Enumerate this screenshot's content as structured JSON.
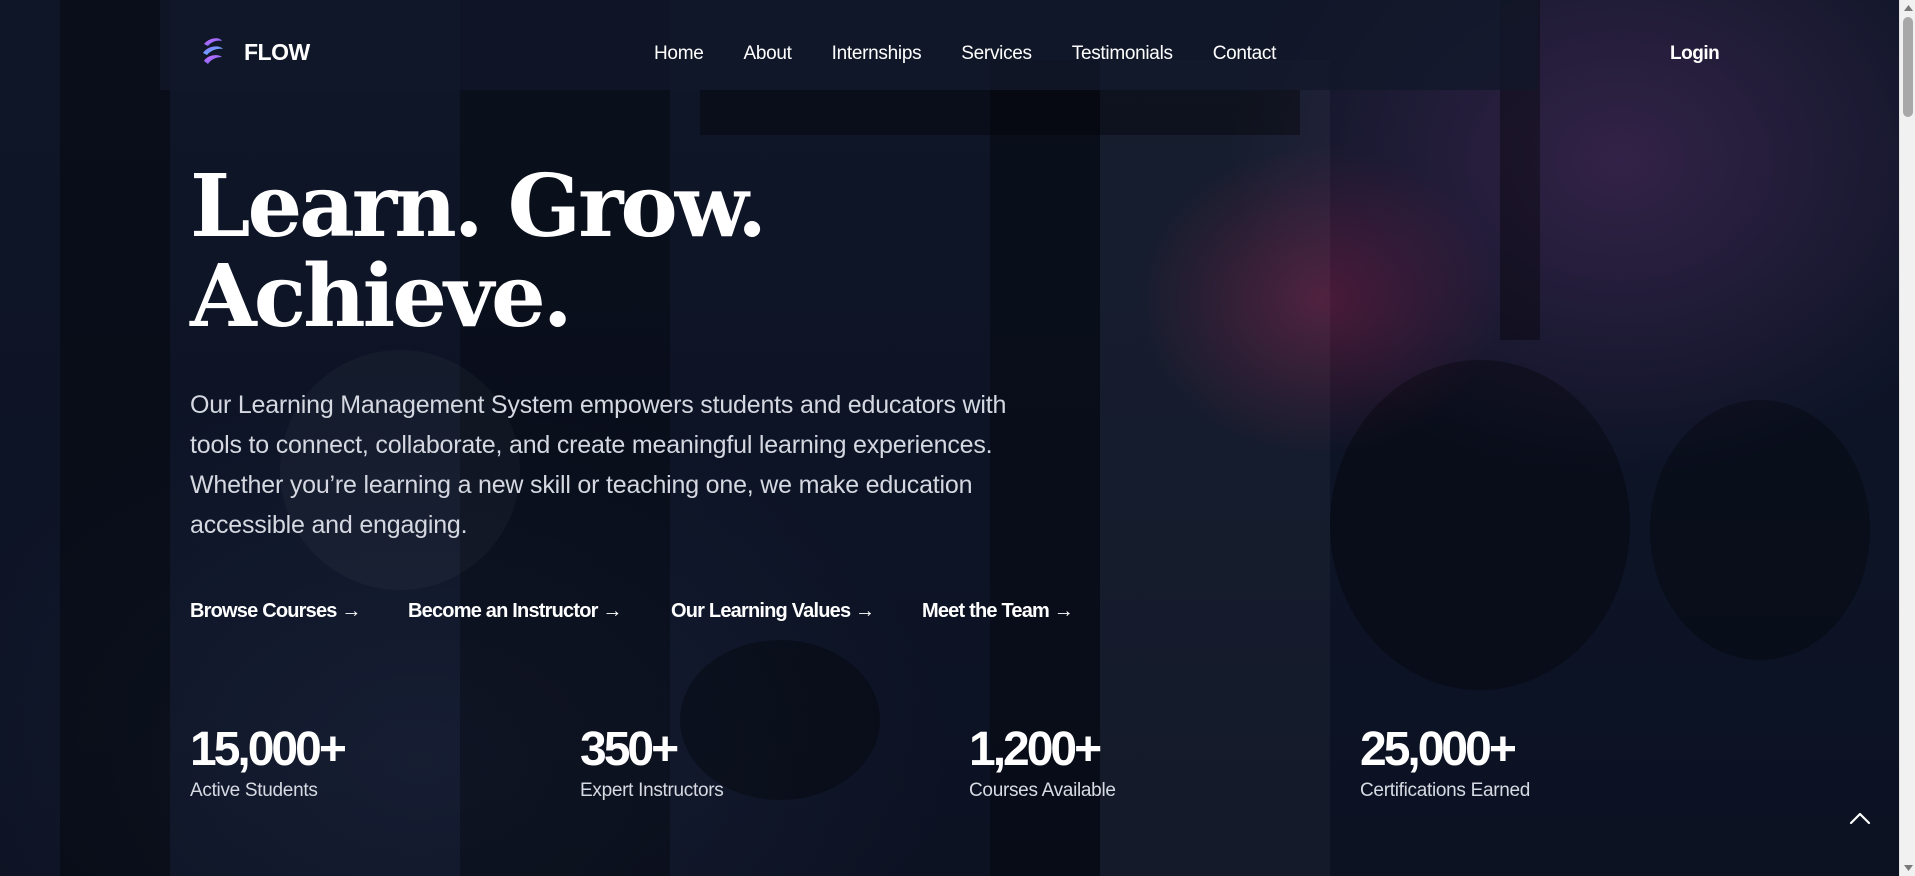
{
  "navbar": {
    "brand": "FLOW",
    "logo_icon": "flow-logo-icon",
    "links": [
      "Home",
      "About",
      "Internships",
      "Services",
      "Testimonials",
      "Contact"
    ],
    "login": "Login"
  },
  "hero": {
    "title_line1": "Learn. Grow.",
    "title_line2": "Achieve.",
    "description": "Our Learning Management System empowers students and educators with tools to connect, collaborate, and create meaningful learning experiences. Whether you’re learning a new skill or teaching one, we make education accessible and engaging.",
    "ctas": [
      "Browse Courses →",
      "Become an Instructor →",
      "Our Learning Values →",
      "Meet the Team →"
    ]
  },
  "stats": [
    {
      "value": "15,000+",
      "label": "Active Students"
    },
    {
      "value": "350+",
      "label": "Expert Instructors"
    },
    {
      "value": "1,200+",
      "label": "Courses Available"
    },
    {
      "value": "25,000+",
      "label": "Certifications Earned"
    }
  ],
  "back_to_top_icon": "chevron-up-icon",
  "colors": {
    "background": "#0d1426",
    "text": "#ffffff",
    "muted_text": "#d5d8e0",
    "accent_purple": "#7b5cff",
    "accent_cyan": "#3fd0ff"
  }
}
